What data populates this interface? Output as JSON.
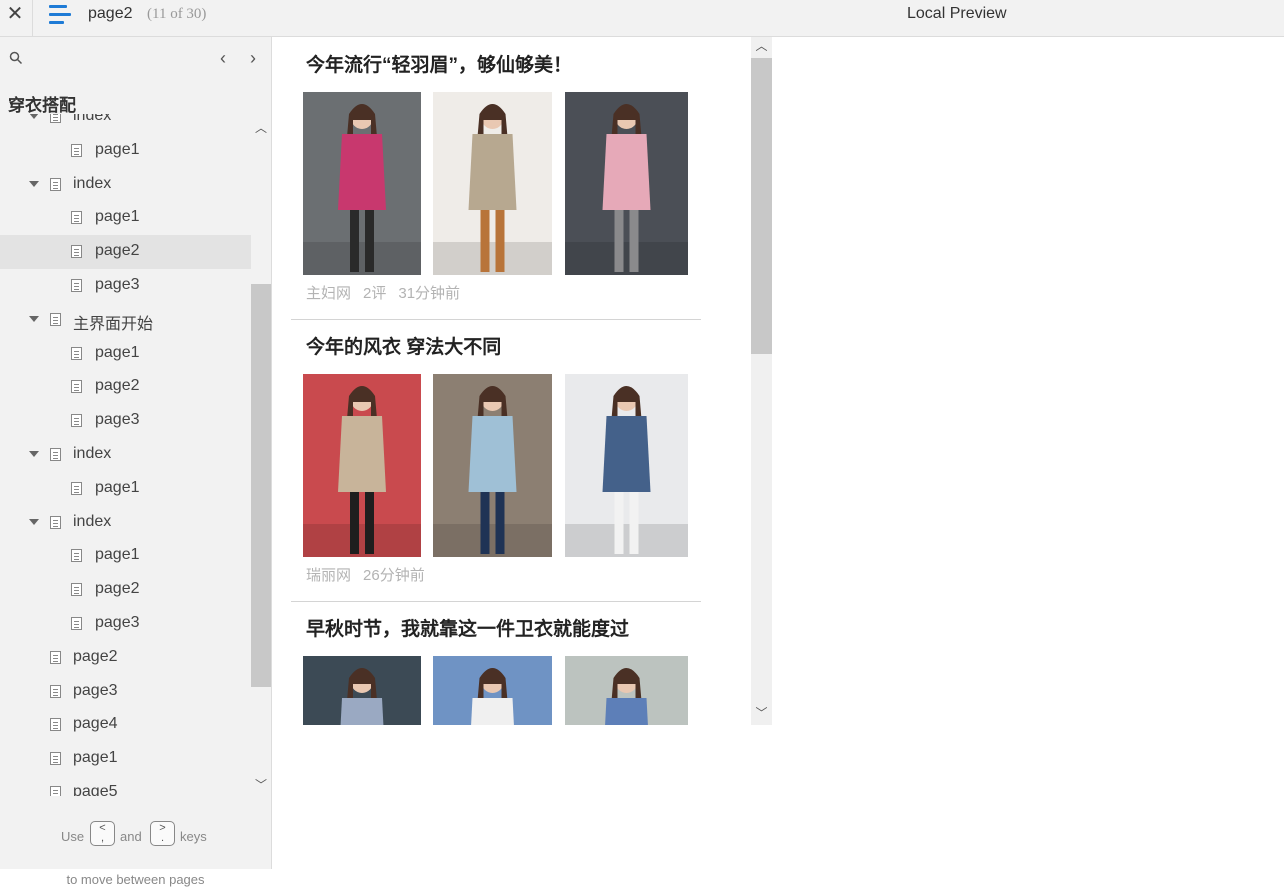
{
  "topbar": {
    "close_symbol": "✕",
    "page_title": "page2",
    "page_count": "(11 of 30)",
    "preview_title": "Local Preview"
  },
  "sidebar": {
    "project_title": "穿衣搭配",
    "nav_prev": "‹",
    "nav_next": "›",
    "tree": [
      {
        "label": "index",
        "level": 0,
        "expanded": true
      },
      {
        "label": "page1",
        "level": 1
      },
      {
        "label": "index",
        "level": 0,
        "expanded": true
      },
      {
        "label": "page1",
        "level": 1
      },
      {
        "label": "page2",
        "level": 1,
        "selected": true
      },
      {
        "label": "page3",
        "level": 1
      },
      {
        "label": "主界面开始",
        "level": 0,
        "expanded": true
      },
      {
        "label": "page1",
        "level": 1
      },
      {
        "label": "page2",
        "level": 1
      },
      {
        "label": "page3",
        "level": 1
      },
      {
        "label": "index",
        "level": 0,
        "expanded": true
      },
      {
        "label": "page1",
        "level": 1
      },
      {
        "label": "index",
        "level": 0,
        "expanded": true
      },
      {
        "label": "page1",
        "level": 1
      },
      {
        "label": "page2",
        "level": 1
      },
      {
        "label": "page3",
        "level": 1
      },
      {
        "label": "page2",
        "level": 0,
        "leaf": true
      },
      {
        "label": "page3",
        "level": 0,
        "leaf": true
      },
      {
        "label": "page4",
        "level": 0,
        "leaf": true
      },
      {
        "label": "page1",
        "level": 0,
        "leaf": true
      },
      {
        "label": "page5",
        "level": 0,
        "leaf": true
      }
    ],
    "hint": {
      "use": "Use",
      "and": "and",
      "keys": "keys",
      "key_prev": "<\n,",
      "key_next": ">\n.",
      "line2": "to move between pages"
    }
  },
  "preview": {
    "articles": [
      {
        "title": "今年流行“轻羽眉”，够仙够美！",
        "meta": [
          "主妇网",
          "2评",
          "31分钟前"
        ],
        "images": [
          {
            "name": "pink-dress-photo",
            "bg": "#6b6f72",
            "cloth": "#c8386e",
            "legs": "#2a2a2a"
          },
          {
            "name": "plaid-shirt-photo",
            "bg": "#efece8",
            "cloth": "#b7a890",
            "legs": "#b8743a"
          },
          {
            "name": "pink-cardigan-photo",
            "bg": "#4b4f56",
            "cloth": "#e6a9b8",
            "legs": "#8a8a8c"
          }
        ]
      },
      {
        "title": "今年的风衣  穿法大不同",
        "meta": [
          "瑞丽网",
          "26分钟前"
        ],
        "images": [
          {
            "name": "red-wall-sweater-photo",
            "bg": "#c94a4e",
            "cloth": "#c8b49a",
            "legs": "#1e1e1e"
          },
          {
            "name": "denim-jacket-photo",
            "bg": "#8c7f72",
            "cloth": "#9fc0d6",
            "legs": "#1f3355"
          },
          {
            "name": "blue-denim-jacket-photo",
            "bg": "#e9eaec",
            "cloth": "#44618a",
            "legs": "#f2f2f2"
          }
        ]
      },
      {
        "title": "早秋时节，我就靠这一件卫衣就能度过",
        "meta": [],
        "images": [
          {
            "name": "hat-girl-street-photo",
            "bg": "#3c4a55",
            "cloth": "#9aa9c2",
            "legs": "#333"
          },
          {
            "name": "sea-girl-photo",
            "bg": "#6f93c4",
            "cloth": "#f0f0f0",
            "legs": "#333"
          },
          {
            "name": "stairs-hat-girl-photo",
            "bg": "#bcc3bf",
            "cloth": "#5d7fb8",
            "legs": "#333"
          }
        ]
      }
    ]
  }
}
